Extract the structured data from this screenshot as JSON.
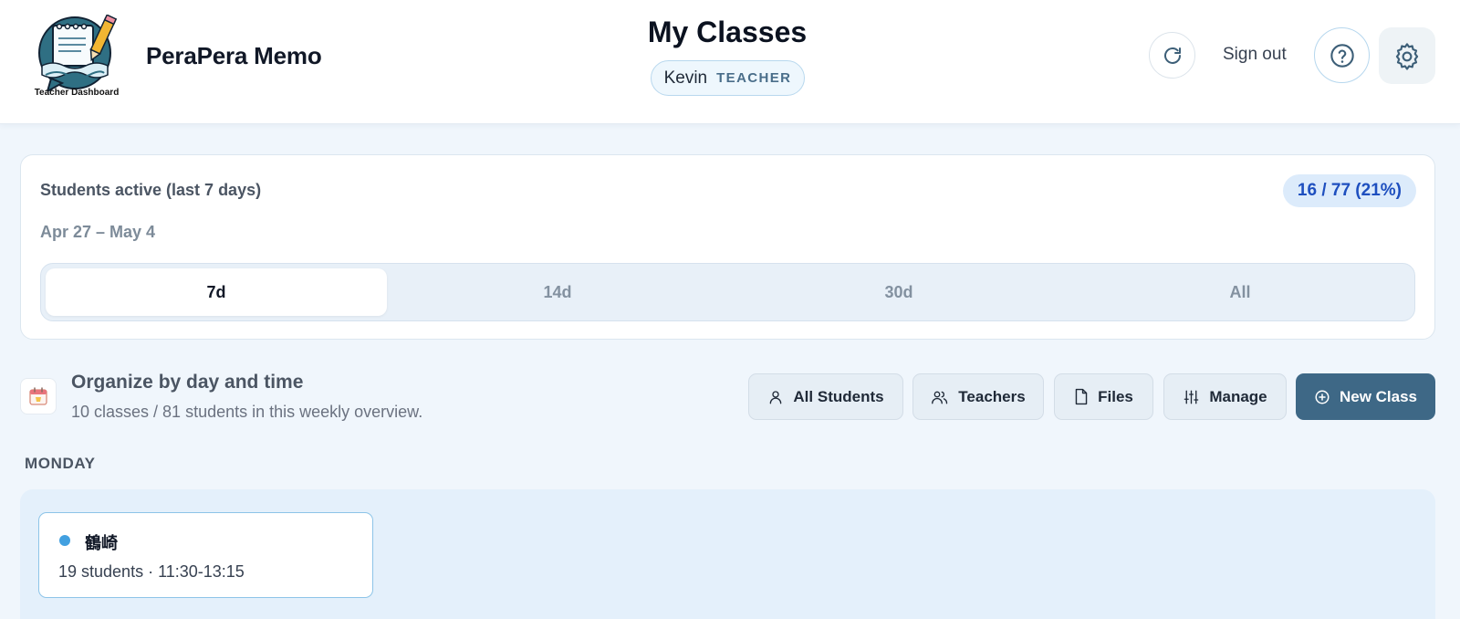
{
  "header": {
    "brand": "PeraPera Memo",
    "logo_caption": "Teacher Dashboard",
    "title": "My Classes",
    "user": {
      "name": "Kevin",
      "role": "TEACHER"
    },
    "refresh_icon": "refresh-icon",
    "signout_label": "Sign out",
    "help_icon": "help-circle-icon",
    "settings_icon": "gear-icon"
  },
  "activity": {
    "title": "Students active (last 7 days)",
    "badge": "16 / 77 (21%)",
    "range": "Apr 27 – May 4",
    "tabs": [
      {
        "label": "7d",
        "active": true
      },
      {
        "label": "14d",
        "active": false
      },
      {
        "label": "30d",
        "active": false
      },
      {
        "label": "All",
        "active": false
      }
    ]
  },
  "organize": {
    "icon": "calendar-icon",
    "title": "Organize by day and time",
    "subtitle": "10 classes / 81 students in this weekly overview."
  },
  "toolbar": {
    "all_students": "All Students",
    "teachers": "Teachers",
    "files": "Files",
    "manage": "Manage",
    "new_class": "New Class"
  },
  "days": [
    {
      "label": "MONDAY",
      "classes": [
        {
          "name": "鶴崎",
          "meta": "19 students · 11:30-13:15",
          "color": "#42a0e0"
        }
      ]
    }
  ],
  "colors": {
    "accent": "#3e6886",
    "badge_text": "#1e4fbf",
    "class_dot": "#42a0e0"
  }
}
